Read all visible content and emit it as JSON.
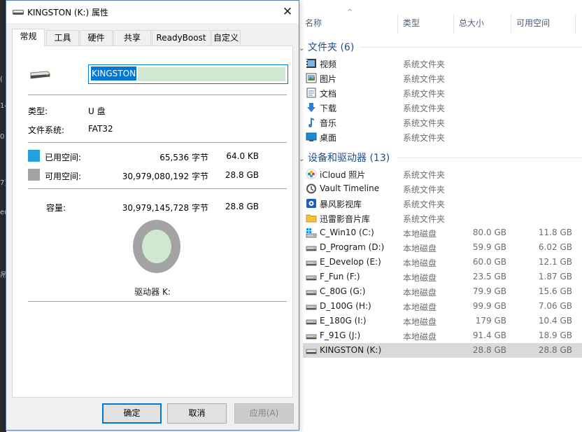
{
  "colors": {
    "used_space": "#26a0da",
    "free_space": "#a3a3a3",
    "group_header": "#1e4e8c",
    "accent": "#0078d7"
  },
  "background_fragments": [
    "(",
    "14",
    "0",
    "7)",
    "er",
    "吊"
  ],
  "dialog": {
    "title": "KINGSTON (K:) 属性",
    "close_glyph": "✕",
    "tabs": [
      "常规",
      "工具",
      "硬件",
      "共享",
      "ReadyBoost",
      "自定义"
    ],
    "active_tab": "常规",
    "drive_icon": "usb-drive-icon",
    "name_value": "KINGSTON",
    "type_label": "类型:",
    "type_value": "U 盘",
    "fs_label": "文件系统:",
    "fs_value": "FAT32",
    "used_label": "已用空间:",
    "used_bytes": "65,536 字节",
    "used_human": "64.0 KB",
    "free_label": "可用空间:",
    "free_bytes": "30,979,080,192 字节",
    "free_human": "28.8 GB",
    "capacity_label": "容量:",
    "capacity_bytes": "30,979,145,728 字节",
    "capacity_human": "28.8 GB",
    "used_fraction": 2.1e-06,
    "drive_caption": "驱动器 K:",
    "buttons": {
      "ok": "确定",
      "cancel": "取消",
      "apply": "应用(A)"
    }
  },
  "explorer": {
    "columns": [
      "名称",
      "类型",
      "总大小",
      "可用空间"
    ],
    "sort_glyph": "^",
    "folders_group": "文件夹 (6)",
    "folders": [
      {
        "icon": "video-folder-icon",
        "name": "视频",
        "type": "系统文件夹"
      },
      {
        "icon": "pictures-folder-icon",
        "name": "图片",
        "type": "系统文件夹"
      },
      {
        "icon": "documents-folder-icon",
        "name": "文档",
        "type": "系统文件夹"
      },
      {
        "icon": "downloads-folder-icon",
        "name": "下载",
        "type": "系统文件夹"
      },
      {
        "icon": "music-folder-icon",
        "name": "音乐",
        "type": "系统文件夹"
      },
      {
        "icon": "desktop-folder-icon",
        "name": "桌面",
        "type": "系统文件夹"
      }
    ],
    "devices_group": "设备和驱动器 (13)",
    "devices": [
      {
        "icon": "icloud-photos-icon",
        "name": "iCloud 照片",
        "type": "系统文件夹",
        "size": "",
        "free": ""
      },
      {
        "icon": "vault-timeline-icon",
        "name": "Vault Timeline",
        "type": "系统文件夹",
        "size": "",
        "free": ""
      },
      {
        "icon": "baofeng-video-icon",
        "name": "暴风影视库",
        "type": "系统文件夹",
        "size": "",
        "free": ""
      },
      {
        "icon": "xunlei-video-icon",
        "name": "迅雷影音片库",
        "type": "系统文件夹",
        "size": "",
        "free": ""
      },
      {
        "icon": "windows-drive-icon",
        "name": "C_Win10 (C:)",
        "type": "本地磁盘",
        "size": "80.0 GB",
        "free": "11.8 GB"
      },
      {
        "icon": "hard-drive-icon",
        "name": "D_Program (D:)",
        "type": "本地磁盘",
        "size": "59.9 GB",
        "free": "6.02 GB"
      },
      {
        "icon": "hard-drive-icon",
        "name": "E_Develop (E:)",
        "type": "本地磁盘",
        "size": "60.0 GB",
        "free": "12.1 GB"
      },
      {
        "icon": "hard-drive-icon",
        "name": "F_Fun (F:)",
        "type": "本地磁盘",
        "size": "23.5 GB",
        "free": "1.87 GB"
      },
      {
        "icon": "hard-drive-icon",
        "name": "C_80G (G:)",
        "type": "本地磁盘",
        "size": "79.9 GB",
        "free": "15.6 GB"
      },
      {
        "icon": "hard-drive-icon",
        "name": "D_100G (H:)",
        "type": "本地磁盘",
        "size": "99.9 GB",
        "free": "7.06 GB"
      },
      {
        "icon": "hard-drive-icon",
        "name": "E_180G (I:)",
        "type": "本地磁盘",
        "size": "179 GB",
        "free": "10.4 GB"
      },
      {
        "icon": "hard-drive-icon",
        "name": "F_91G (J:)",
        "type": "本地磁盘",
        "size": "91.4 GB",
        "free": "18.9 GB"
      },
      {
        "icon": "usb-drive-icon",
        "name": "KINGSTON (K:)",
        "type": "",
        "size": "28.8 GB",
        "free": "28.8 GB",
        "selected": true
      }
    ]
  }
}
